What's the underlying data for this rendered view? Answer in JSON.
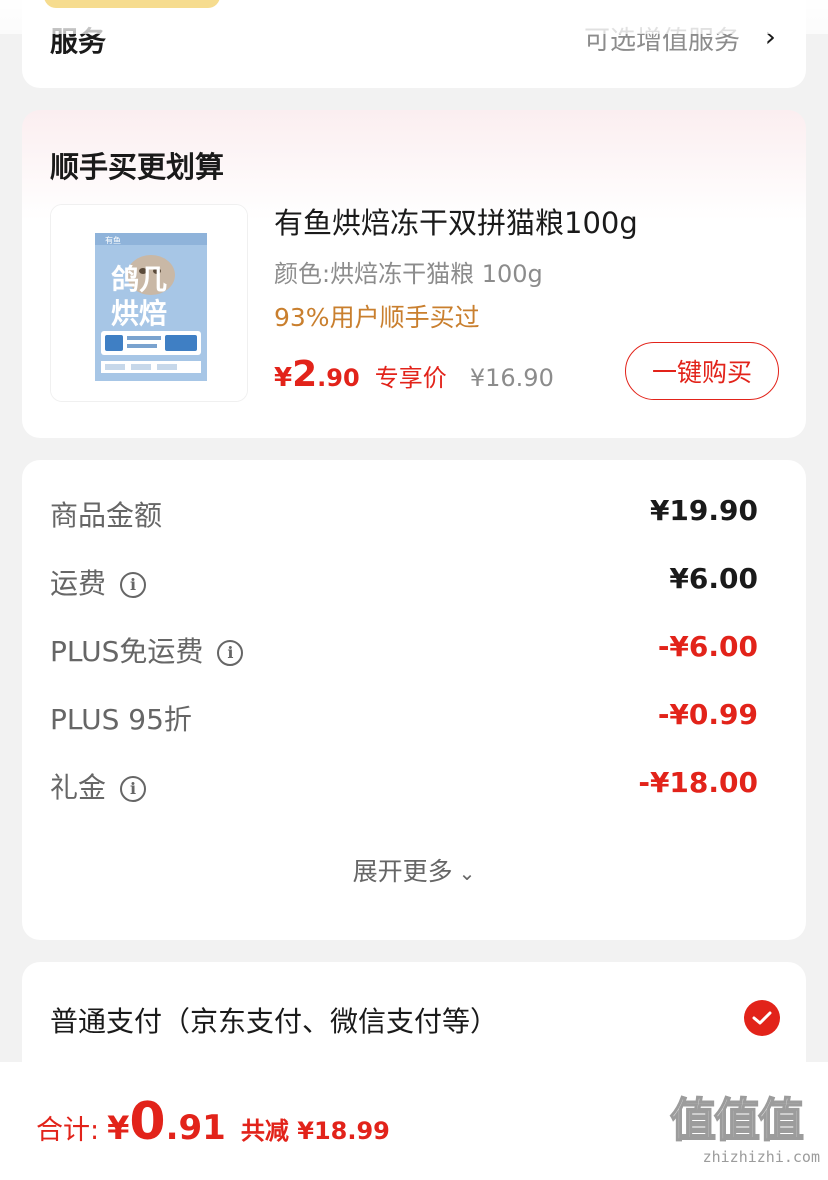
{
  "service": {
    "label": "服务",
    "value": "可选增值服务"
  },
  "addon": {
    "title": "顺手买更划算",
    "product": {
      "name": "有鱼烘焙冻干双拼猫粮100g",
      "variant": "颜色:烘焙冻干猫粮 100g",
      "buyers": "93%用户顺手买过",
      "price_symbol": "¥",
      "price_int": "2",
      "price_dec": ".90",
      "price_tag": "专享价",
      "original_price": "¥16.90",
      "buy_button": "一键购买",
      "image_text": {
        "brand": "有鱼",
        "big1": "鸽几",
        "big2": "烘焙"
      }
    }
  },
  "summary": {
    "rows": [
      {
        "label": "商品金额",
        "value": "¥19.90",
        "info": false,
        "discount": false
      },
      {
        "label": "运费",
        "value": "¥6.00",
        "info": true,
        "discount": false
      },
      {
        "label": "PLUS免运费",
        "value": "-¥6.00",
        "info": true,
        "discount": true
      },
      {
        "label": "PLUS 95折",
        "value": "-¥0.99",
        "info": false,
        "discount": true
      },
      {
        "label": "礼金",
        "value": "-¥18.00",
        "info": true,
        "discount": true
      }
    ],
    "expand_label": "展开更多"
  },
  "payment": {
    "label": "普通支付（京东支付、微信支付等）",
    "selected": true
  },
  "footer": {
    "total_label": "合计:",
    "total_symbol": "¥",
    "total_int": "0",
    "total_dec": ".91",
    "savings": "共减 ¥18.99"
  },
  "watermark": {
    "glyphs": "值值值",
    "url": "zhizhizhi.com"
  },
  "colors": {
    "accent_red": "#e2231a",
    "buyers_orange": "#c97f2e",
    "muted_gray": "#8c8c8c"
  }
}
